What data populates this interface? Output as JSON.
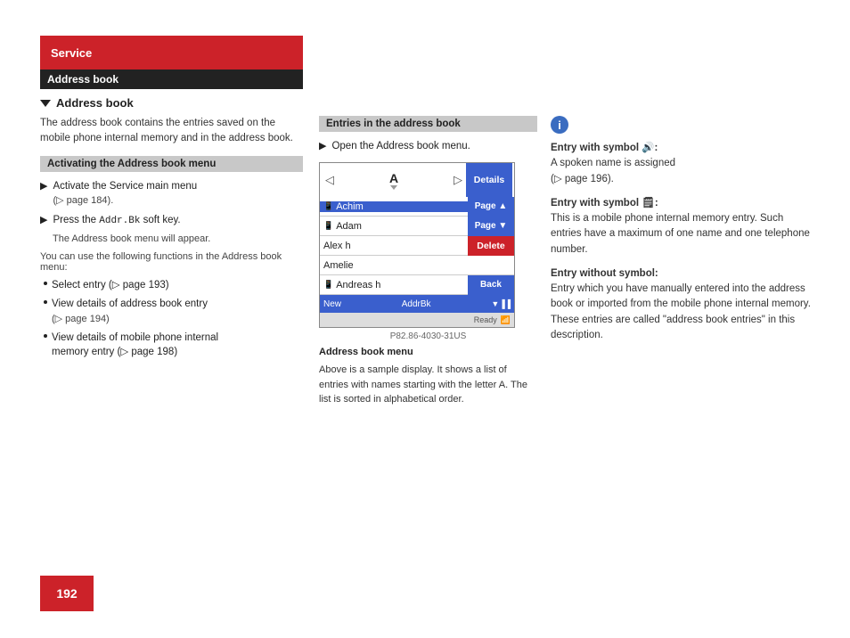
{
  "header": {
    "section_label": "Service",
    "address_book_bar": "Address book",
    "section_sub": "Address book"
  },
  "left": {
    "intro": "The address book contains the entries saved on the mobile phone internal memory and in the address book.",
    "activating_bar": "Activating the Address book menu",
    "step1": "Activate the Service main menu",
    "step1_ref": "(▷ page 184).",
    "step2": "Press the",
    "step2_code": "Addr.Bk",
    "step2_after": " soft key.",
    "step2_result": "The Address book menu will appear.",
    "can_use": "You can use the following functions in the Address book menu:",
    "bullet1": "Select entry (▷ page 193)",
    "bullet2": "View details of address book entry (▷ page 194)",
    "bullet3": "View details of mobile phone internal memory entry (▷ page 198)"
  },
  "middle": {
    "entries_bar": "Entries in the address book",
    "open_instruction": "Open the Address book menu.",
    "screen": {
      "entries": [
        {
          "name": "Achim",
          "selected": true,
          "icon": "📱"
        },
        {
          "name": "Adam",
          "selected": false,
          "icon": "📱"
        },
        {
          "name": "Alex h",
          "selected": false,
          "icon": ""
        },
        {
          "name": "Amelie",
          "selected": false,
          "icon": ""
        },
        {
          "name": "Andreas h",
          "selected": false,
          "icon": "📱"
        }
      ],
      "letter": "A",
      "btn_details": "Details",
      "btn_page_up": "Page ▲",
      "btn_page_down": "Page ▼",
      "btn_delete": "Delete",
      "btn_back": "Back",
      "btn_new": "New",
      "bottom_label": "AddrBk",
      "status": "Ready",
      "figure_id": "P82.86-4030-31US"
    },
    "caption_title": "Address book menu",
    "caption_body": "Above is a sample display. It shows a list of entries with names starting with the letter A. The list is sorted in alphabetical order."
  },
  "right": {
    "info_icon": "i",
    "entry1_title": "Entry with symbol",
    "entry1_sym": "🔊",
    "entry1_body": "A spoken name is assigned (▷ page 196).",
    "entry2_title": "Entry with symbol",
    "entry2_sym": "🗒",
    "entry2_body": "This is a mobile phone internal memory entry. Such entries have a maximum of one name and one telephone number.",
    "entry3_title": "Entry without symbol:",
    "entry3_body": "Entry which you have manually entered into the address book or imported from the mobile phone internal memory. These entries are called \"address book entries\" in this description."
  },
  "page_number": "192"
}
